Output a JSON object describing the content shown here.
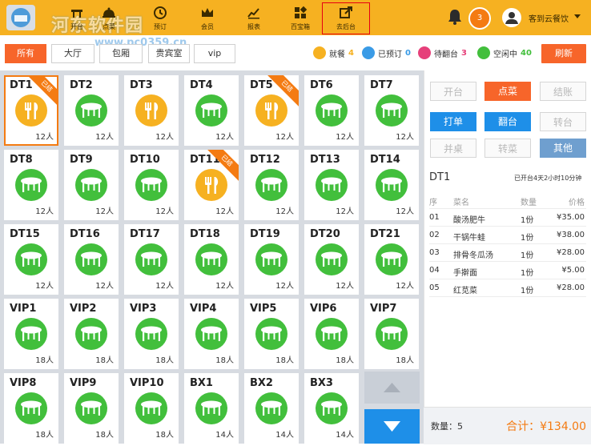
{
  "watermark": {
    "site": "河东软件园",
    "url": "www.pc0359.cn"
  },
  "colors": {
    "brand": "#f6b121",
    "accent": "#f7652a",
    "free": "#42bf3c",
    "busy": "#f6b121",
    "blue": "#1e8fe8"
  },
  "nav": [
    {
      "label": "开台",
      "icon": "table-icon"
    },
    {
      "label": "点菜",
      "icon": "bell-cover-icon"
    },
    {
      "label": "预订",
      "icon": "clock-icon"
    },
    {
      "label": "会员",
      "icon": "crown-icon"
    },
    {
      "label": "报表",
      "icon": "chart-icon"
    },
    {
      "label": "百宝箱",
      "icon": "grid-icon"
    },
    {
      "label": "去后台",
      "icon": "external-link-icon"
    }
  ],
  "header": {
    "notify_count": "3",
    "username": "客到云餐饮"
  },
  "filters": [
    "所有",
    "大厅",
    "包厢",
    "贵宾室",
    "vip"
  ],
  "legend": [
    {
      "label": "就餐",
      "count": "4",
      "color": "#f6b121"
    },
    {
      "label": "已预订",
      "count": "0",
      "color": "#3a9be6"
    },
    {
      "label": "待翻台",
      "count": "3",
      "color": "#e6407a"
    },
    {
      "label": "空闲中",
      "count": "40",
      "color": "#42bf3c"
    }
  ],
  "refresh_label": "刷新",
  "tables": [
    {
      "name": "DT1",
      "cap": "12人",
      "status": "busy",
      "tag": "已结"
    },
    {
      "name": "DT2",
      "cap": "12人",
      "status": "free"
    },
    {
      "name": "DT3",
      "cap": "12人",
      "status": "busy"
    },
    {
      "name": "DT4",
      "cap": "12人",
      "status": "free"
    },
    {
      "name": "DT5",
      "cap": "12人",
      "status": "busy",
      "tag": "已结"
    },
    {
      "name": "DT6",
      "cap": "12人",
      "status": "free"
    },
    {
      "name": "DT7",
      "cap": "12人",
      "status": "free"
    },
    {
      "name": "DT8",
      "cap": "12人",
      "status": "free"
    },
    {
      "name": "DT9",
      "cap": "12人",
      "status": "free"
    },
    {
      "name": "DT10",
      "cap": "12人",
      "status": "free"
    },
    {
      "name": "DT11",
      "cap": "12人",
      "status": "busy",
      "tag": "已结"
    },
    {
      "name": "DT12",
      "cap": "12人",
      "status": "free"
    },
    {
      "name": "DT13",
      "cap": "12人",
      "status": "free"
    },
    {
      "name": "DT14",
      "cap": "12人",
      "status": "free"
    },
    {
      "name": "DT15",
      "cap": "12人",
      "status": "free"
    },
    {
      "name": "DT16",
      "cap": "12人",
      "status": "free"
    },
    {
      "name": "DT17",
      "cap": "12人",
      "status": "free"
    },
    {
      "name": "DT18",
      "cap": "12人",
      "status": "free"
    },
    {
      "name": "DT19",
      "cap": "12人",
      "status": "free"
    },
    {
      "name": "DT20",
      "cap": "12人",
      "status": "free"
    },
    {
      "name": "DT21",
      "cap": "12人",
      "status": "free"
    },
    {
      "name": "VIP1",
      "cap": "18人",
      "status": "free"
    },
    {
      "name": "VIP2",
      "cap": "18人",
      "status": "free"
    },
    {
      "name": "VIP3",
      "cap": "18人",
      "status": "free"
    },
    {
      "name": "VIP4",
      "cap": "18人",
      "status": "free"
    },
    {
      "name": "VIP5",
      "cap": "18人",
      "status": "free"
    },
    {
      "name": "VIP6",
      "cap": "18人",
      "status": "free"
    },
    {
      "name": "VIP7",
      "cap": "18人",
      "status": "free"
    },
    {
      "name": "VIP8",
      "cap": "18人",
      "status": "free"
    },
    {
      "name": "VIP9",
      "cap": "18人",
      "status": "free"
    },
    {
      "name": "VIP10",
      "cap": "18人",
      "status": "free"
    },
    {
      "name": "BX1",
      "cap": "14人",
      "status": "free"
    },
    {
      "name": "BX2",
      "cap": "14人",
      "status": "free"
    },
    {
      "name": "BX3",
      "cap": "14人",
      "status": "free"
    }
  ],
  "actions": [
    {
      "label": "开台",
      "style": "disabled"
    },
    {
      "label": "点菜",
      "style": "orange"
    },
    {
      "label": "结账",
      "style": "disabled"
    },
    {
      "label": "打单",
      "style": "blue"
    },
    {
      "label": "翻台",
      "style": "blue"
    },
    {
      "label": "转台",
      "style": "disabled"
    },
    {
      "label": "并桌",
      "style": "disabled"
    },
    {
      "label": "转菜",
      "style": "disabled"
    },
    {
      "label": "其他",
      "style": "bluegray"
    }
  ],
  "order": {
    "table": "DT1",
    "elapsed": "已开台4天2小时10分钟",
    "columns": [
      "序",
      "菜名",
      "数量",
      "价格"
    ],
    "items": [
      {
        "no": "01",
        "name": "酸汤肥牛",
        "qty": "1份",
        "price": "¥35.00"
      },
      {
        "no": "02",
        "name": "干锅牛蛙",
        "qty": "1份",
        "price": "¥38.00"
      },
      {
        "no": "03",
        "name": "排骨冬瓜汤",
        "qty": "1份",
        "price": "¥28.00"
      },
      {
        "no": "04",
        "name": "手擀面",
        "qty": "1份",
        "price": "¥5.00"
      },
      {
        "no": "05",
        "name": "红苋菜",
        "qty": "1份",
        "price": "¥28.00"
      }
    ],
    "quantity_text": "数量：5",
    "total_text": "合计：¥134.00"
  }
}
